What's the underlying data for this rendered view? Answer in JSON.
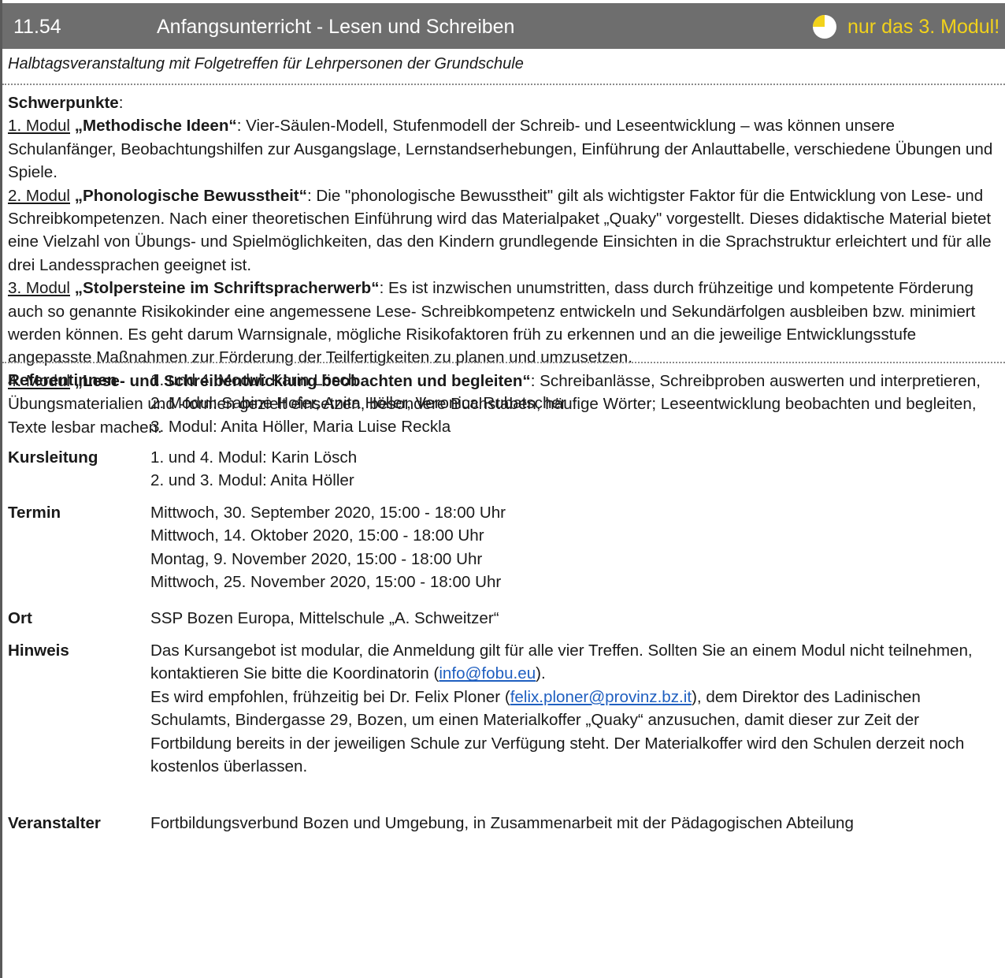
{
  "header": {
    "code": "11.54",
    "title": "Anfangsunterricht - Lesen und Schreiben",
    "note": "nur das 3. Modul!",
    "note_color": "#f2d21b",
    "pie_icon": "quarter-pie-icon"
  },
  "subtitle": "Halbtagsveranstaltung  mit Folgetreffen für Lehrpersonen der Grundschule",
  "schwerpunkte": {
    "heading": "Schwerpunkte",
    "heading_suffix": ":",
    "modules": [
      {
        "prefix": "1. Modul",
        "title": "„Methodische Ideen“",
        "text": ": Vier-Säulen-Modell, Stufenmodell der Schreib- und Leseentwicklung – was können unsere Schulanfänger, Beobachtungshilfen zur Ausgangslage, Lernstandserhebungen, Einführung der Anlauttabelle, verschiedene Übungen und Spiele."
      },
      {
        "prefix": "2. Modul",
        "title": "„Phonologische Bewusstheit“",
        "text": ":  Die \"phonologische Bewusstheit\" gilt als wichtigster Faktor für die Entwicklung von Lese- und Schreibkompetenzen. Nach einer theoretischen Einführung wird das Materialpaket „Quaky\" vorgestellt. Dieses didaktische Material bietet eine Vielzahl von Übungs- und Spielmöglichkeiten, das den  Kindern grundlegende Einsichten in die Sprachstruktur erleichtert und für alle drei Landessprachen geeignet ist."
      },
      {
        "prefix": "3. Modul",
        "title": " „Stolpersteine im Schriftspracherwerb“",
        "text": ":  Es ist inzwischen unumstritten, dass durch frühzeitige und kompetente Förderung auch so genannte Risikokinder eine angemessene Lese- Schreibkompetenz entwickeln und Sekundärfolgen ausbleiben bzw. minimiert werden können. Es geht darum Warnsignale, mögliche Risikofaktoren früh zu erkennen und an die jeweilige Entwicklungsstufe angepasste Maßnahmen zur Förderung der Teilfertigkeiten zu planen und umzusetzen."
      },
      {
        "prefix": "4. Modul",
        "title": "„Lese- und Schreibentwicklung beobachten und begleiten“",
        "text": ": Schreibanlässe, Schreibproben auswerten und interpretieren, Übungsmaterialien und -formen gezielt einsetzen, besondere Buchstaben, häufige Wörter; Leseentwicklung beobachten und begleiten, Texte lesbar machen."
      }
    ]
  },
  "details": {
    "referentinnen": {
      "label": "Referentinnen",
      "lines": [
        "1. und 4. Modul: Karin Lösch",
        "2. Modul: Sabine Hofer, Anita Höller, Veronica Rubatscher",
        "3. Modul: Anita Höller, Maria Luise Reckla"
      ]
    },
    "kursleitung": {
      "label": "Kursleitung",
      "lines": [
        "1. und 4. Modul: Karin Lösch",
        "2. und 3. Modul: Anita Höller"
      ]
    },
    "termin": {
      "label": "Termin",
      "lines": [
        "Mittwoch, 30. September 2020, 15:00 - 18:00 Uhr",
        "Mittwoch, 14. Oktober 2020, 15:00 - 18:00 Uhr",
        "Montag, 9. November 2020, 15:00 - 18:00 Uhr",
        "Mittwoch, 25. November 2020, 15:00 - 18:00 Uhr"
      ]
    },
    "ort": {
      "label": "Ort",
      "text": "SSP Bozen Europa, Mittelschule „A. Schweitzer“"
    },
    "hinweis": {
      "label": "Hinweis",
      "p1_before": "Das Kursangebot ist modular, die Anmeldung gilt für alle vier Treffen. Sollten Sie an einem Modul nicht teilnehmen, kontaktieren Sie bitte die Koordinatorin (",
      "p1_link": "info@fobu.eu",
      "p1_after": ").",
      "p2_before": "Es wird empfohlen, frühzeitig bei Dr. Felix Ploner (",
      "p2_link": "felix.ploner@provinz.bz.it",
      "p2_after": "), dem Direktor des Ladinischen Schulamts, Bindergasse 29, Bozen, um einen Materialkoffer „Quaky“ anzusuchen, damit dieser zur Zeit der Fortbildung bereits in der jeweiligen Schule zur Verfügung steht. Der Materialkoffer wird den Schulen derzeit noch kostenlos überlassen."
    },
    "veranstalter": {
      "label": "Veranstalter",
      "text": "Fortbildungsverbund Bozen und Umgebung, in Zusammenarbeit mit der Pädagogischen Abteilung"
    }
  }
}
